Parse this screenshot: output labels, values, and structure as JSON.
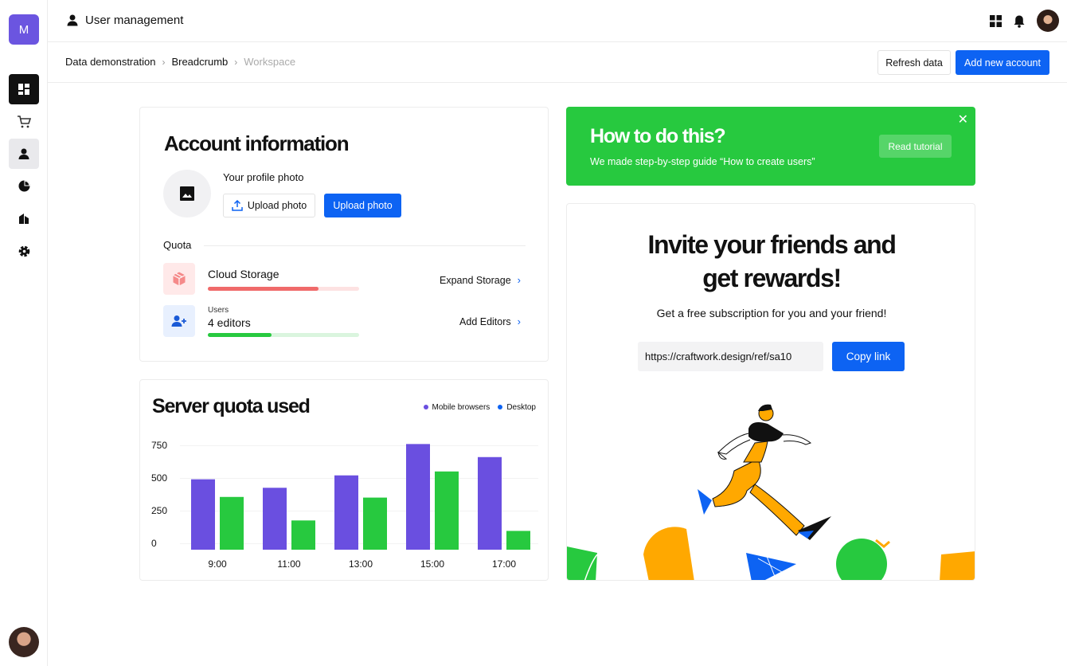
{
  "app": {
    "logo_letter": "M",
    "title": "User management"
  },
  "sidebar": {
    "items": [
      {
        "icon": "dashboard-icon"
      },
      {
        "icon": "cart-icon"
      },
      {
        "icon": "user-icon"
      },
      {
        "icon": "pie-chart-icon"
      },
      {
        "icon": "building-icon"
      },
      {
        "icon": "settings-icon"
      }
    ]
  },
  "breadcrumb": {
    "items": [
      "Data demonstration",
      "Breadcrumb",
      "Workspace"
    ]
  },
  "toolbar": {
    "refresh_label": "Refresh data",
    "add_label": "Add new account"
  },
  "account": {
    "title": "Account information",
    "photo_label": "Your profile photo",
    "upload_outline_label": "Upload photo",
    "upload_primary_label": "Upload photo",
    "quota_label": "Quota",
    "storage": {
      "title": "Cloud Storage",
      "link": "Expand Storage",
      "progress": 0.73,
      "color": "#f06a6a"
    },
    "users": {
      "small": "Users",
      "title": "4 editors",
      "link": "Add Editors",
      "progress": 0.42,
      "color": "#27c93f"
    }
  },
  "server": {
    "title": "Server quota used",
    "legend": [
      {
        "name": "Mobile browsers",
        "color": "#6a4fe0"
      },
      {
        "name": "Desktop",
        "color": "#0d63f3"
      }
    ]
  },
  "chart_data": {
    "type": "bar",
    "categories": [
      "9:00",
      "11:00",
      "13:00",
      "15:00",
      "17:00"
    ],
    "series": [
      {
        "name": "Mobile browsers",
        "color": "#6a4fe0",
        "values": [
          490,
          425,
          520,
          760,
          660
        ]
      },
      {
        "name": "Desktop",
        "color": "#27c93f",
        "values": [
          355,
          175,
          350,
          550,
          95
        ]
      }
    ],
    "yticks": [
      0,
      250,
      500,
      750
    ],
    "ylim": [
      0,
      750
    ],
    "grid": true
  },
  "tutorial": {
    "title": "How to do this?",
    "text": "We made step-by-step guide “How to create users”",
    "button": "Read tutorial",
    "close": "✕"
  },
  "invite": {
    "title_line1": "Invite your friends and",
    "title_line2": "get rewards!",
    "subtitle": "Get a free subscription for you and your friend!",
    "link_value": "https://craftwork.design/ref/sa10",
    "copy_label": "Copy link"
  }
}
